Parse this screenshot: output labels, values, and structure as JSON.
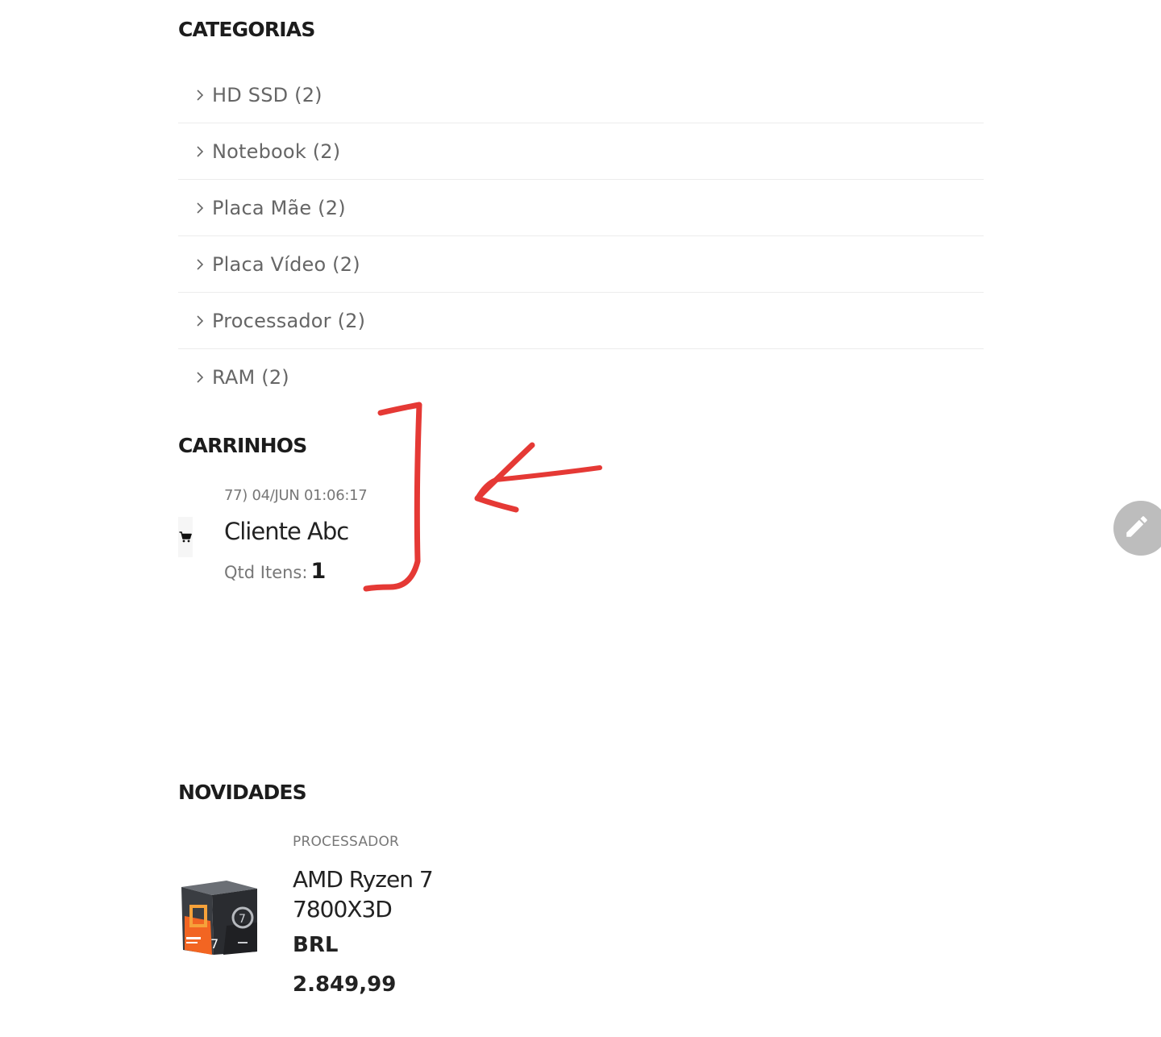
{
  "categories": {
    "title": "CATEGORIAS",
    "items": [
      {
        "label": "HD SSD (2)"
      },
      {
        "label": "Notebook (2)"
      },
      {
        "label": "Placa Mãe (2)"
      },
      {
        "label": "Placa Vídeo (2)"
      },
      {
        "label": "Processador (2)"
      },
      {
        "label": "RAM (2)"
      }
    ]
  },
  "carts": {
    "title": "CARRINHOS",
    "entry": {
      "date": "77) 04/JUN 01:06:17",
      "client": "Cliente Abc",
      "qty_label": "Qtd Itens:",
      "qty_value": "1",
      "icon": "cart-icon"
    }
  },
  "news": {
    "title": "NOVIDADES",
    "product": {
      "category": "PROCESSADOR",
      "name": "AMD Ryzen 7 7800X3D",
      "currency": "BRL",
      "price": "2.849,99",
      "image": "product-box-image"
    }
  },
  "fab": {
    "icon": "pencil-icon"
  },
  "annotation": {
    "color": "#e53935"
  }
}
